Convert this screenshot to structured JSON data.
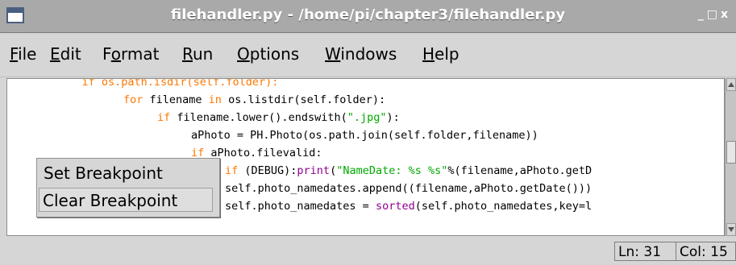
{
  "window": {
    "title": "filehandler.py - /home/pi/chapter3/filehandler.py",
    "controls": [
      "_",
      "□",
      "x"
    ]
  },
  "menu": [
    {
      "mnemonic": "F",
      "rest": "ile"
    },
    {
      "mnemonic": "E",
      "rest": "dit"
    },
    {
      "pre": "F",
      "mnemonic": "o",
      "rest": "rmat"
    },
    {
      "mnemonic": "R",
      "rest": "un"
    },
    {
      "mnemonic": "O",
      "rest": "ptions"
    },
    {
      "mnemonic": "W",
      "rest": "indows"
    },
    {
      "mnemonic": "H",
      "rest": "elp"
    }
  ],
  "code": {
    "line1": "    if os.path.isdir(self.folder):",
    "line2_kw": "for",
    "line2_mid": " filename ",
    "line2_kw2": "in",
    "line2_rest": " os.listdir(self.folder):",
    "line3_kw": "if",
    "line3_mid": " filename.lower().endswith(",
    "line3_str": "\".jpg\"",
    "line3_rest": "):",
    "line4": "aPhoto = PH.Photo(os.path.join(self.folder,filename))",
    "line5_kw": "if",
    "line5_rest": " aPhoto.filevalid:",
    "line6_kw": "if",
    "line6_mid": " (DEBUG):",
    "line6_bi": "print",
    "line6_pre": "(",
    "line6_str": "\"NameDate: %s %s\"",
    "line6_rest": "%(filename,aPhoto.getD",
    "line7": "self.photo_namedates.append((filename,aPhoto.getDate()))",
    "line8_pre": "self.photo_namedates = ",
    "line8_bi": "sorted",
    "line8_rest": "(self.photo_namedates,key=l"
  },
  "context_menu": {
    "set_breakpoint": "Set Breakpoint",
    "clear_breakpoint": "Clear Breakpoint"
  },
  "status": {
    "line": "Ln: 31",
    "col": "Col: 15"
  }
}
